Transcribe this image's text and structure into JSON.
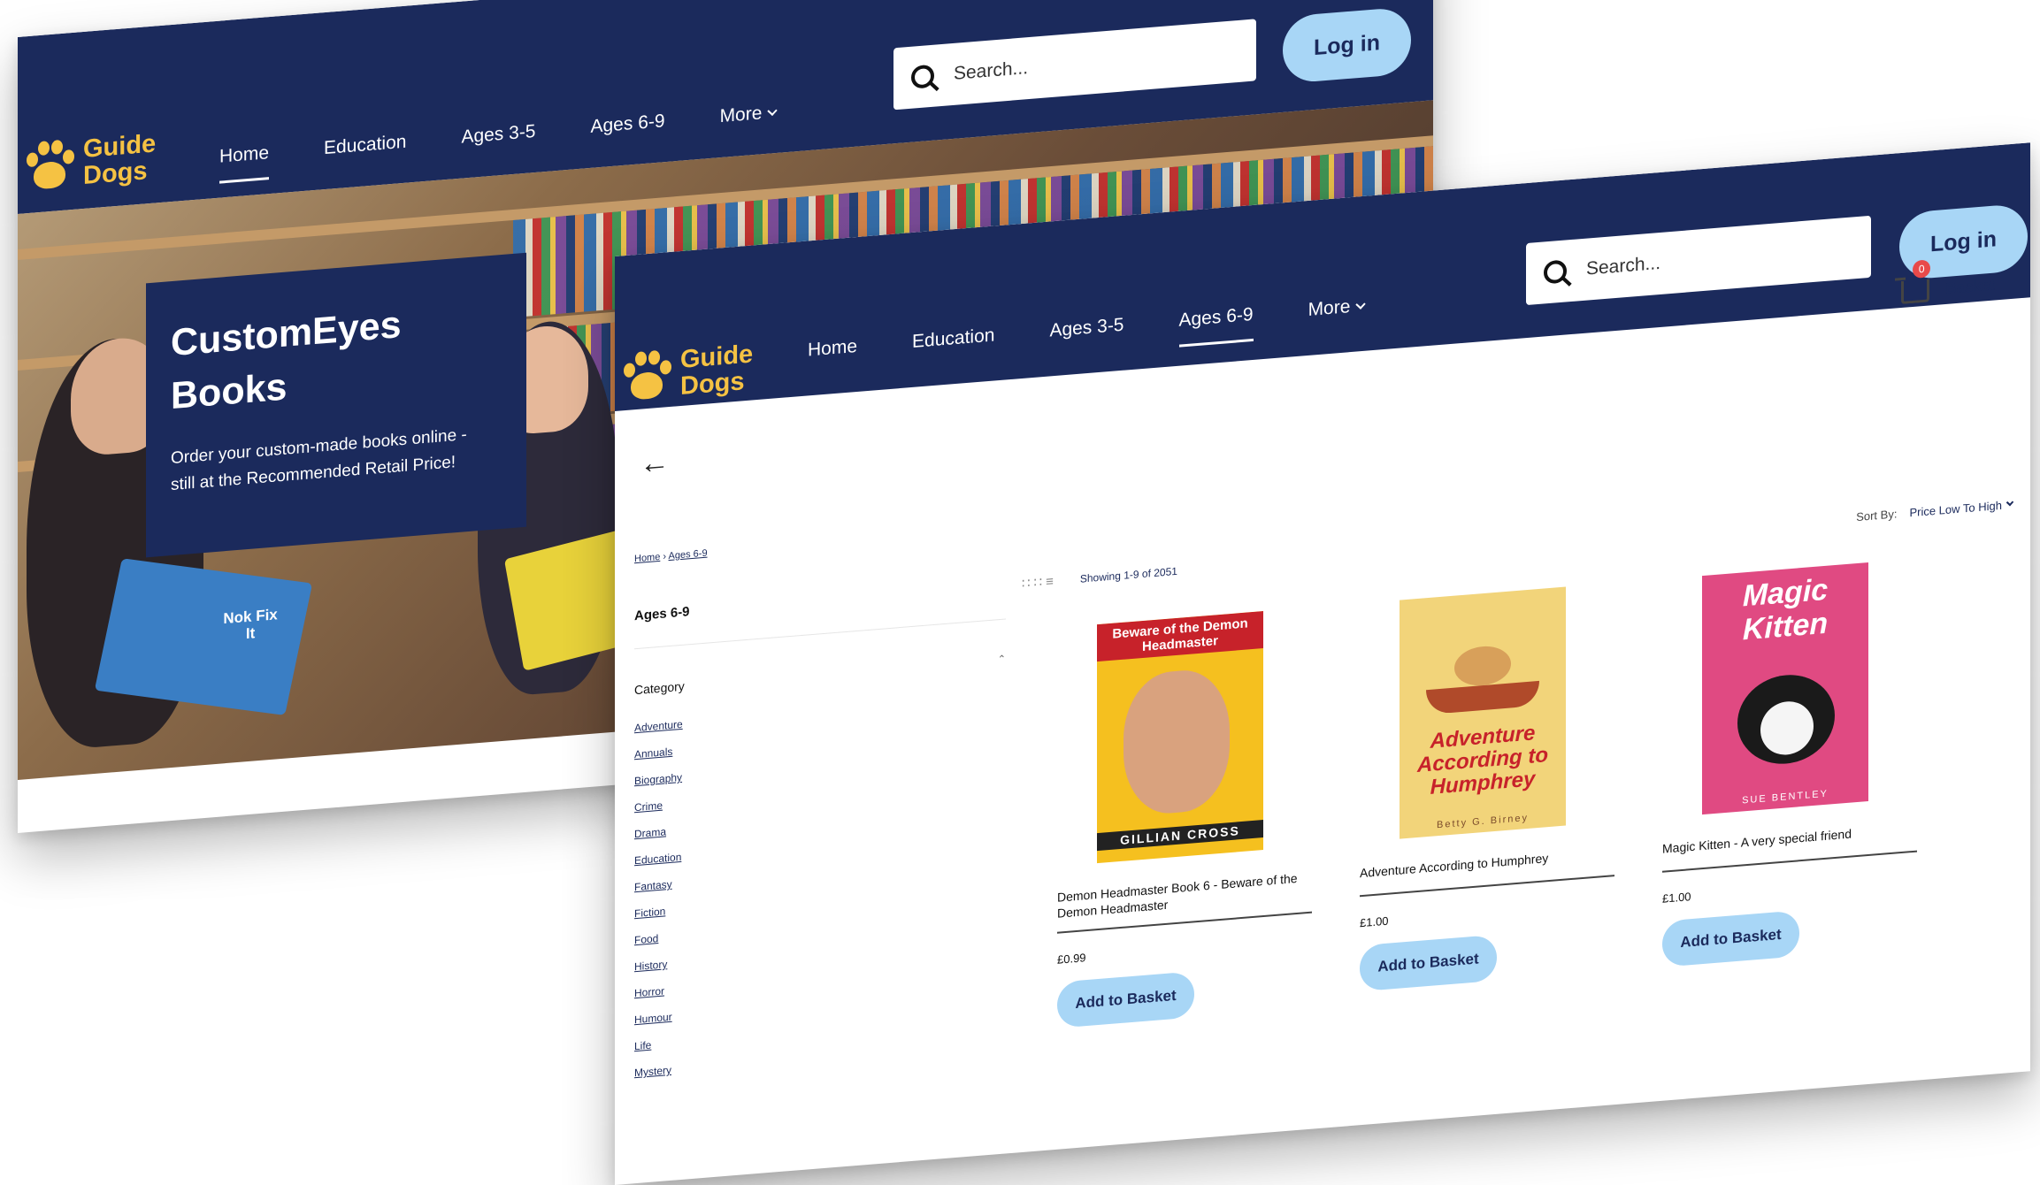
{
  "brand": {
    "name_line1": "Guide",
    "name_line2": "Dogs"
  },
  "nav": {
    "items": [
      "Home",
      "Education",
      "Ages 3-5",
      "Ages 6-9"
    ],
    "more_label": "More"
  },
  "search": {
    "placeholder": "Search..."
  },
  "login_label": "Log in",
  "hero": {
    "title_line1": "CustomEyes",
    "title_line2": "Books",
    "subtitle_line1": "Order your custom-made books online -",
    "subtitle_line2": "still at the Recommended Retail Price!",
    "magazine_text": "Nok Fix It"
  },
  "basket": {
    "label": "Basket",
    "count": "0"
  },
  "breadcrumb": {
    "home": "Home",
    "separator": "›",
    "current": "Ages 6-9"
  },
  "sidebar": {
    "title": "Ages 6-9",
    "category_heading": "Category",
    "categories": [
      "Adventure",
      "Annuals",
      "Biography",
      "Crime",
      "Drama",
      "Education",
      "Fantasy",
      "Fiction",
      "Food",
      "History",
      "Horror",
      "Humour",
      "Life",
      "Mystery"
    ]
  },
  "results": {
    "showing": "Showing 1-9 of 2051",
    "sort_label": "Sort By:",
    "sort_value": "Price Low To High"
  },
  "products": [
    {
      "name": "Demon Headmaster Book 6 - Beware of the Demon Headmaster",
      "price": "£0.99",
      "button": "Add to Basket",
      "cover_title": "Beware of the Demon Headmaster",
      "cover_author": "GILLIAN CROSS"
    },
    {
      "name": "Adventure According to Humphrey",
      "price": "£1.00",
      "button": "Add to Basket",
      "cover_title": "Adventure According to Humphrey",
      "cover_author": "Betty G. Birney"
    },
    {
      "name": "Magic Kitten - A very special friend",
      "price": "£1.00",
      "button": "Add to Basket",
      "cover_title": "Magic Kitten",
      "cover_author": "SUE BENTLEY"
    }
  ],
  "colors": {
    "navy": "#1b2a5c",
    "accent_blue": "#a8d6f6",
    "logo_yellow": "#f5c243",
    "badge_red": "#e84a4a"
  },
  "icons": {
    "search": "search-icon",
    "cart": "cart-icon",
    "back": "back-arrow-icon",
    "chevron": "chevron-down-icon",
    "paw": "paw-logo-icon",
    "grid": "grid-view-icon",
    "list": "list-view-icon"
  }
}
